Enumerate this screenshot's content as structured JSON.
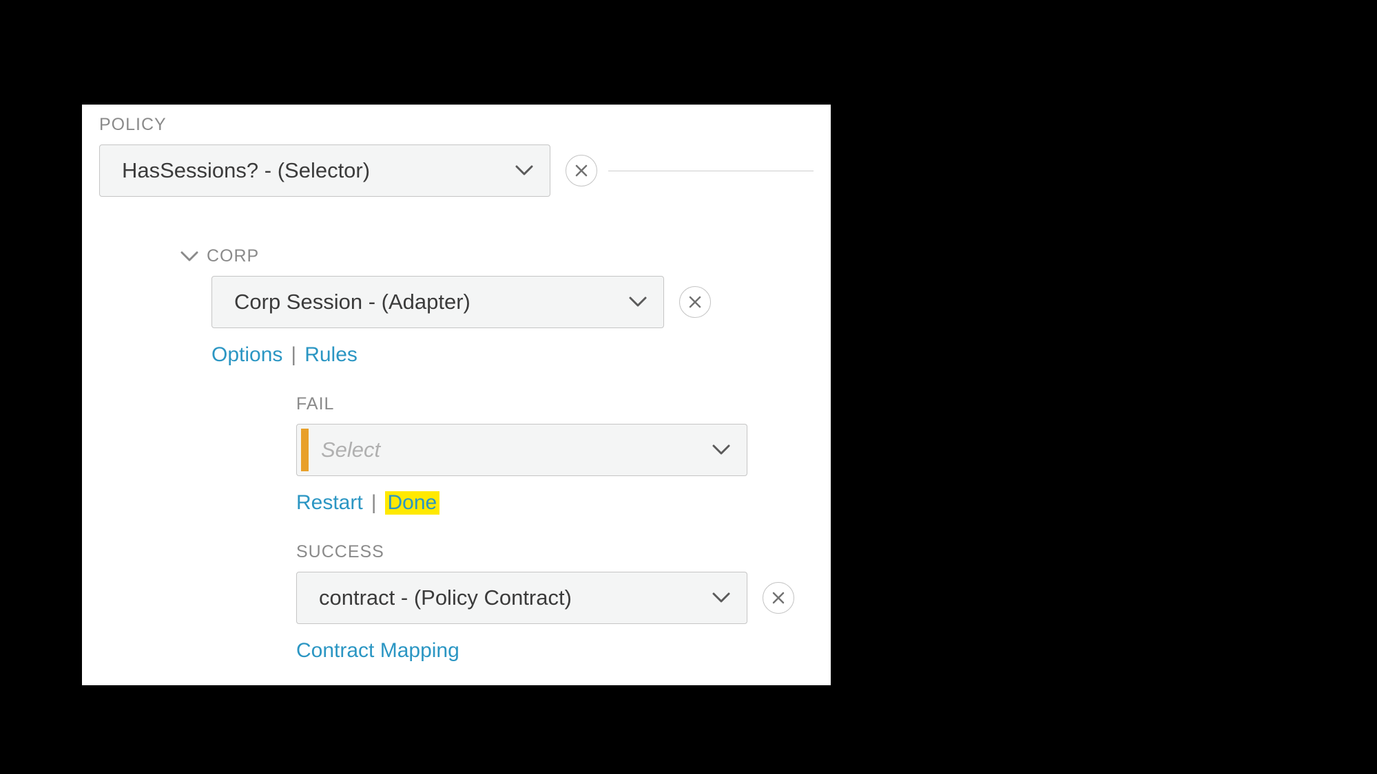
{
  "policy": {
    "label": "POLICY",
    "dropdown_value": "HasSessions? - (Selector)"
  },
  "corp": {
    "label": "CORP",
    "dropdown_value": "Corp Session - (Adapter)",
    "links": {
      "options": "Options",
      "rules": "Rules"
    }
  },
  "fail": {
    "label": "FAIL",
    "placeholder": "Select",
    "links": {
      "restart": "Restart",
      "done": "Done"
    }
  },
  "success": {
    "label": "SUCCESS",
    "dropdown_value": "contract - (Policy Contract)",
    "links": {
      "contract_mapping": "Contract Mapping"
    }
  }
}
